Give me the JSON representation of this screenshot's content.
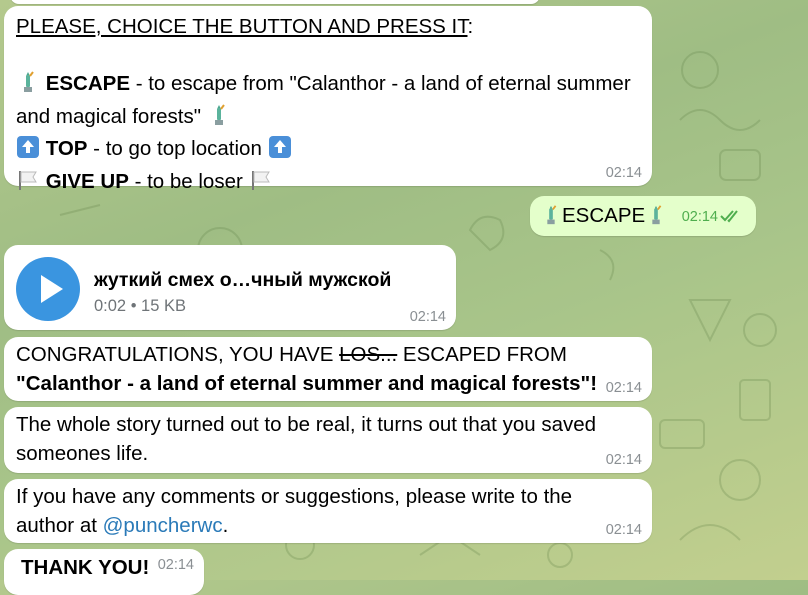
{
  "chat": {
    "menu": {
      "heading": "PLEASE, CHOICE THE BUTTON AND PRESS IT",
      "heading_suffix": ":",
      "escape_label": "ESCAPE",
      "escape_text": " - to escape from \"Calanthor - a land of eternal summer and magical forests\" ",
      "top_label": "TOP",
      "top_text": " - to go top location ",
      "giveup_label": "GIVE UP",
      "giveup_text": " - to be loser ",
      "time": "02:14"
    },
    "reply": {
      "text": "ESCAPE",
      "time": "02:14",
      "status_icon": "double-check-icon"
    },
    "audio": {
      "title": "жуткий смех о…чный мужской",
      "meta": "0:02 • 15 KB",
      "time": "02:14"
    },
    "congrats": {
      "prefix": "CONGRATULATIONS, YOU HAVE ",
      "strike": "LOS...",
      "middle": " ESCAPED FROM",
      "quote_open": "\"",
      "place": "Calanthor - a land of eternal summer and magical forests",
      "quote_close": "\"!",
      "time": "02:14"
    },
    "story": {
      "text": "The whole story turned out to be real, it turns out that you saved someones life.",
      "time": "02:14"
    },
    "comments": {
      "text": "If you have any comments or suggestions, please write to the author at ",
      "link": "@puncherwc",
      "suffix": ".",
      "time": "02:14"
    },
    "thanks": {
      "text": "THANK YOU!",
      "time": "02:14"
    }
  },
  "colors": {
    "incoming_bubble": "#ffffff",
    "outgoing_bubble": "#e4ffcb",
    "link": "#2a7ab8",
    "play_button": "#3a95e0",
    "outgoing_time": "#4fae4e"
  }
}
